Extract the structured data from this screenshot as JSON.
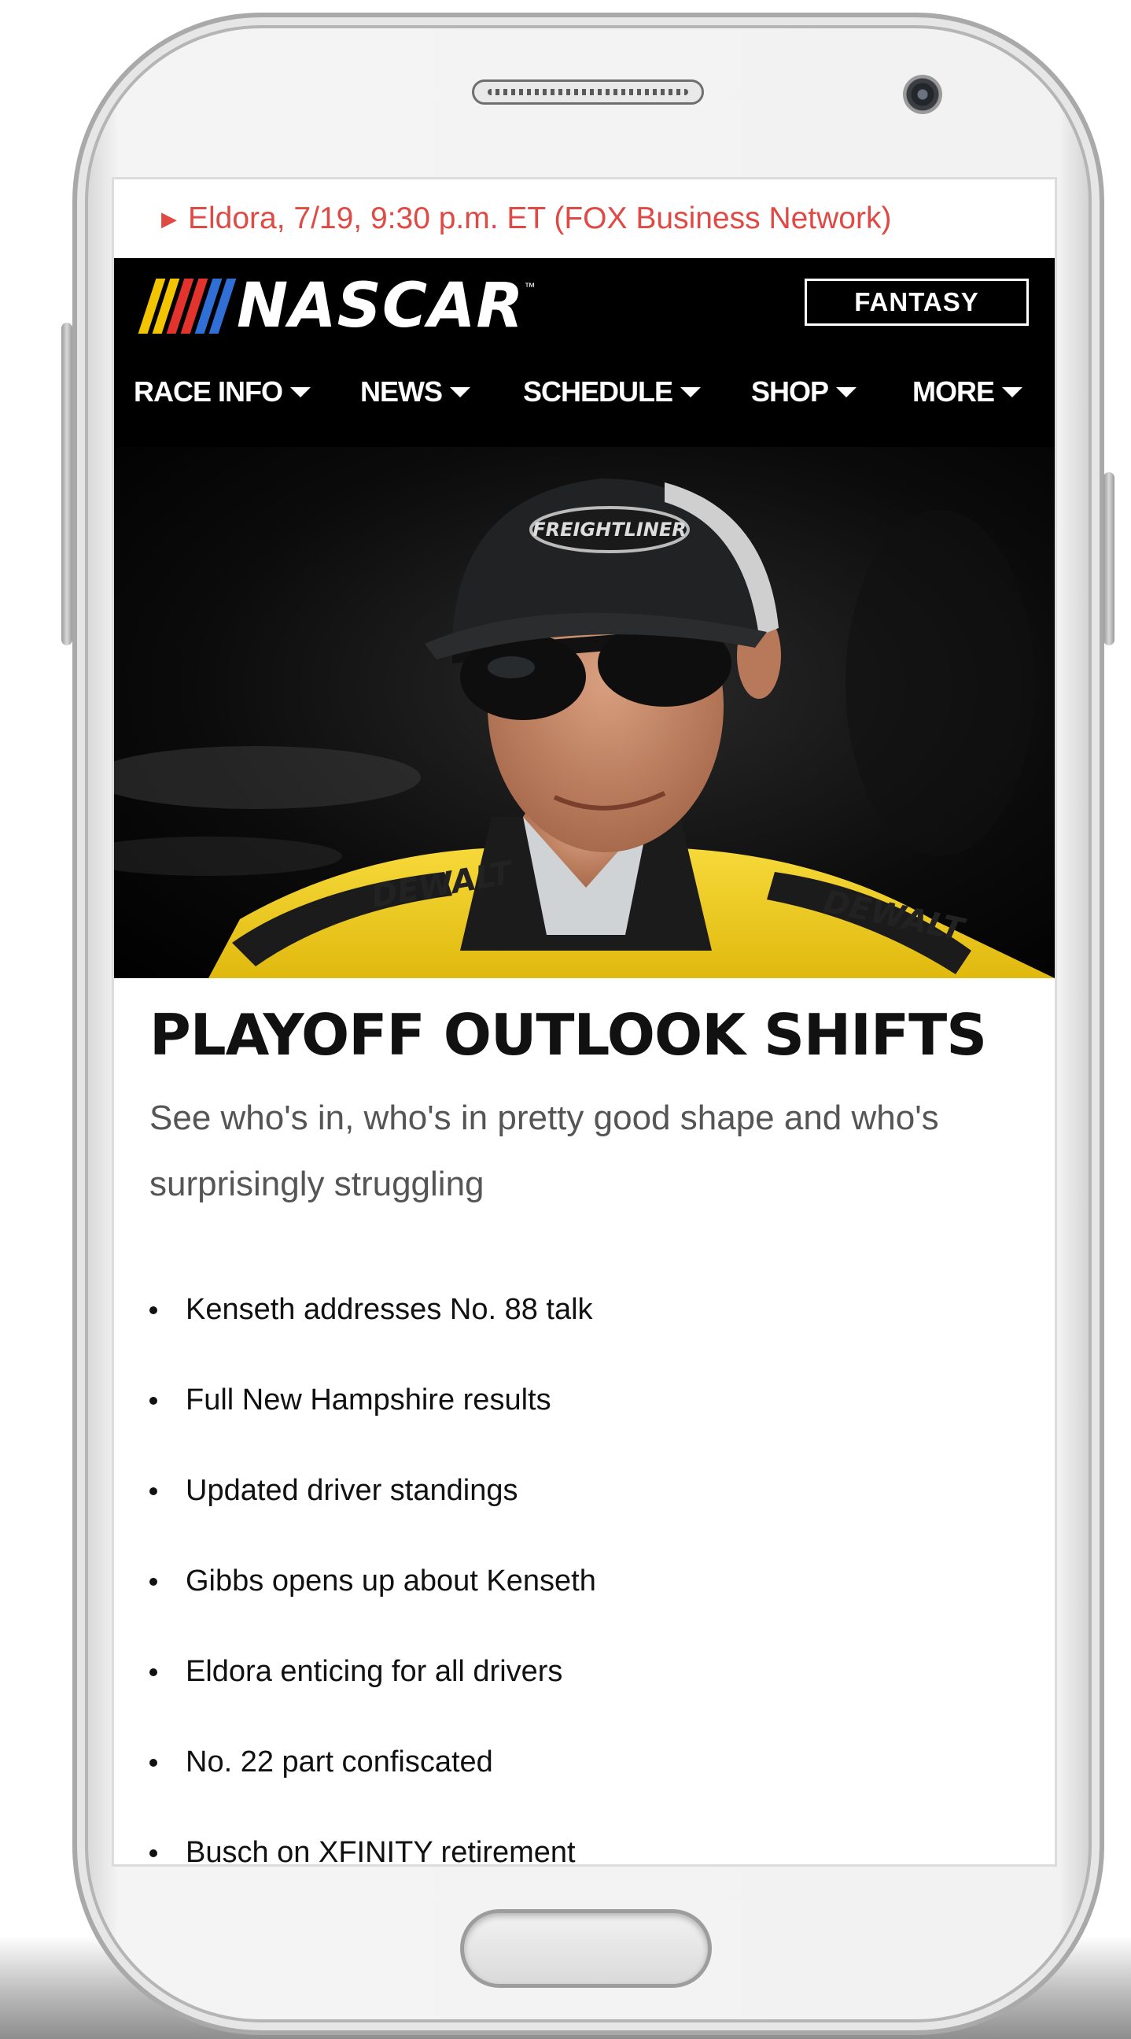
{
  "alert": {
    "text": "Eldora, 7/19, 9:30 p.m. ET (FOX Business Network)"
  },
  "header": {
    "logo_text": "NASCAR",
    "logo_stripe_colors": [
      "#f2c500",
      "#e2342d",
      "#2f6fd6"
    ],
    "fantasy_label": "FANTASY"
  },
  "nav": {
    "items": [
      {
        "label": "RACE INFO"
      },
      {
        "label": "NEWS"
      },
      {
        "label": "SCHEDULE"
      },
      {
        "label": "SHOP"
      },
      {
        "label": "MORE"
      }
    ]
  },
  "hero": {
    "cap_text": "FREIGHTLINER",
    "suit_text": "DEWALT"
  },
  "article": {
    "headline": "PLAYOFF OUTLOOK SHIFTS",
    "deck_line1": "See who's in, who's in pretty good shape and who's",
    "deck_line2": "surprisingly struggling",
    "links": [
      "Kenseth addresses No. 88 talk",
      "Full New Hampshire results",
      "Updated driver standings",
      "Gibbs opens up about Kenseth",
      "Eldora enticing for all drivers",
      "No. 22 part confiscated",
      "Busch on XFINITY retirement"
    ]
  },
  "colors": {
    "alert_red": "#e04a45",
    "header_black": "#000000",
    "suit_yellow": "#f4d21f"
  }
}
